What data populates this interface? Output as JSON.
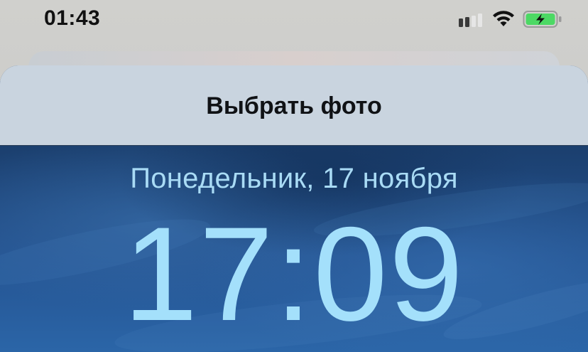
{
  "status_bar": {
    "time": "01:43",
    "icons": [
      "cellular-signal-icon",
      "wifi-icon",
      "battery-charging-icon"
    ],
    "battery_color": "#4cd964"
  },
  "sheet": {
    "title": "Выбрать фото"
  },
  "lock_screen_preview": {
    "date": "Понедельник, 17 ноября",
    "time": "17:09",
    "text_color": "#a4e0fb"
  }
}
